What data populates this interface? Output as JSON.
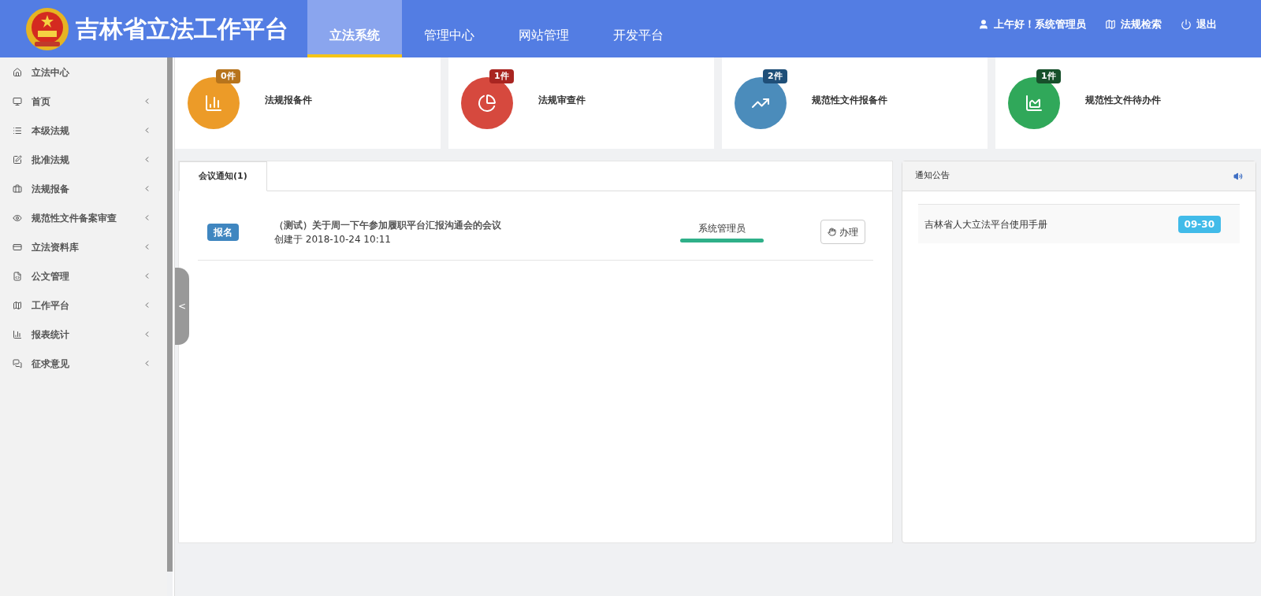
{
  "header": {
    "title": "吉林省立法工作平台",
    "nav": [
      {
        "label": "立法系统",
        "selected": true
      },
      {
        "label": "管理中心",
        "selected": false
      },
      {
        "label": "网站管理",
        "selected": false
      },
      {
        "label": "开发平台",
        "selected": false
      }
    ],
    "links": [
      {
        "kind": "user",
        "label": "上午好！系统管理员"
      },
      {
        "kind": "map",
        "label": "法规检索"
      },
      {
        "kind": "power",
        "label": "退出"
      }
    ]
  },
  "sidebar": {
    "items": [
      {
        "label": "立法中心",
        "expandable": false
      },
      {
        "label": "首页",
        "expandable": true
      },
      {
        "label": "本级法规",
        "expandable": true
      },
      {
        "label": "批准法规",
        "expandable": true
      },
      {
        "label": "法规报备",
        "expandable": true
      },
      {
        "label": "规范性文件备案审查",
        "expandable": true
      },
      {
        "label": "立法资料库",
        "expandable": true
      },
      {
        "label": "公文管理",
        "expandable": true
      },
      {
        "label": "工作平台",
        "expandable": true
      },
      {
        "label": "报表统计",
        "expandable": true
      },
      {
        "label": "征求意见",
        "expandable": true
      }
    ],
    "collapse_handle": "<"
  },
  "stats": [
    {
      "label": "法规报备件",
      "count": "0件",
      "color": "#ec9b28"
    },
    {
      "label": "法规审查件",
      "count": "1件",
      "color": "#d6493e"
    },
    {
      "label": "规范性文件报备件",
      "count": "2件",
      "color": "#4b8cbb"
    },
    {
      "label": "规范性文件待办件",
      "count": "1件",
      "color": "#30a85a"
    }
  ],
  "meetings": {
    "tabs": [
      {
        "label": "会议通知(1)",
        "selected": true
      }
    ],
    "rows": [
      {
        "tag": "报名",
        "title": "（测试）关于周一下午参加履职平台汇报沟通会的会议",
        "created": "创建于 2018-10-24 10:11",
        "person": "系统管理员",
        "level": 1,
        "action": "办理"
      }
    ]
  },
  "notices": {
    "title": "通知公告",
    "items": [
      {
        "title": "吉林省人大立法平台使用手册",
        "date": "09-30"
      }
    ]
  }
}
